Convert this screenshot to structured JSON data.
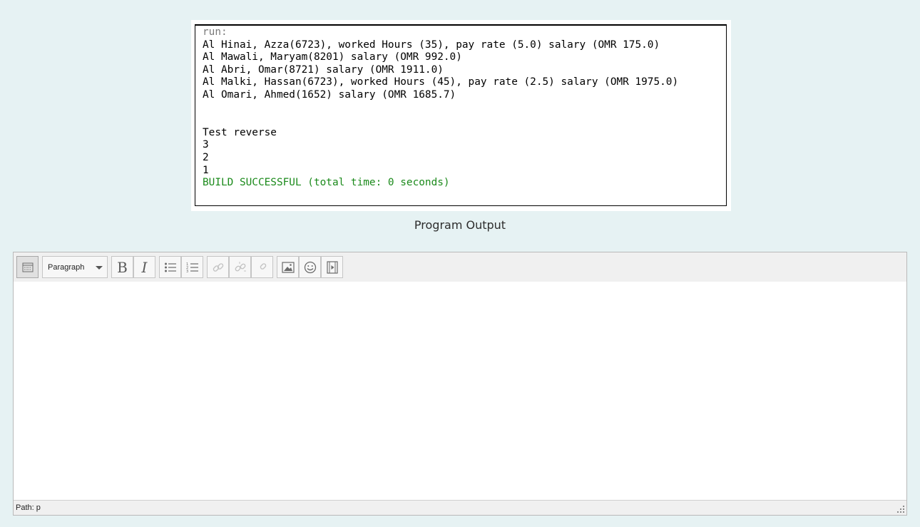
{
  "output": {
    "run_label": "run:",
    "lines": [
      "Al Hinai, Azza(6723), worked Hours (35), pay rate (5.0) salary (OMR 175.0)",
      "Al Mawali, Maryam(8201) salary (OMR 992.0)",
      "Al Abri, Omar(8721) salary (OMR 1911.0)",
      "Al Malki, Hassan(6723), worked Hours (45), pay rate (2.5) salary (OMR 1975.0)",
      "Al Omari, Ahmed(1652) salary (OMR 1685.7)",
      "",
      "",
      "Test reverse",
      "3",
      "2",
      "1"
    ],
    "build_status": "BUILD SUCCESSFUL (total time: 0 seconds)"
  },
  "caption": "Program Output",
  "editor": {
    "block_format": "Paragraph",
    "content": "",
    "status_path": "Path: p"
  },
  "colors": {
    "background": "#e6f2f3",
    "build_success": "#1b8a1b"
  }
}
